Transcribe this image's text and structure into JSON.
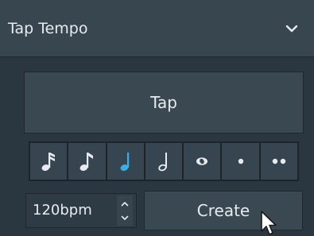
{
  "panel": {
    "title": "Tap Tempo"
  },
  "tap_button": {
    "label": "Tap"
  },
  "note_values": {
    "items": [
      {
        "name": "sixteenth-note",
        "selected": false
      },
      {
        "name": "eighth-note",
        "selected": false
      },
      {
        "name": "quarter-note",
        "selected": true
      },
      {
        "name": "half-note",
        "selected": false
      },
      {
        "name": "whole-note",
        "selected": false
      },
      {
        "name": "dotted",
        "selected": false
      },
      {
        "name": "double-dotted",
        "selected": false
      }
    ],
    "colors": {
      "normal": "#e6ebef",
      "selected": "#3aaee8"
    }
  },
  "bpm": {
    "value": "120bpm"
  },
  "create_button": {
    "label": "Create"
  }
}
